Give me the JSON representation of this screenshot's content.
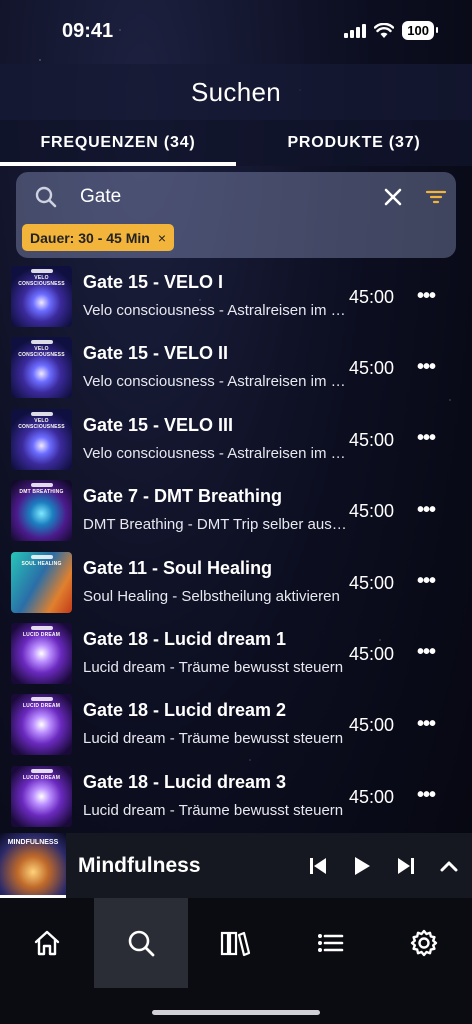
{
  "status_bar": {
    "time": "09:41",
    "battery": "100",
    "icons": [
      "signal-icon",
      "wifi-icon",
      "battery-icon"
    ]
  },
  "header": {
    "title": "Suchen"
  },
  "tabs": [
    {
      "label": "FREQUENZEN (34)",
      "active": true
    },
    {
      "label": "PRODUKTE (37)",
      "active": false
    }
  ],
  "search": {
    "value": "Gate",
    "placeholder": "Suchen",
    "icons": [
      "search-icon",
      "close-icon",
      "filter-icon"
    ],
    "filter_chip": {
      "label": "Dauer: 30 - 45 Min",
      "remove": "×"
    }
  },
  "results": [
    {
      "title": "Gate 15 - VELO I",
      "subtitle": "Velo consciousness - Astralreisen im Klarbewusstsein",
      "duration": "45:00",
      "thumb_label": "VELO CONSCIOUSNESS",
      "thumb_style": "velo"
    },
    {
      "title": "Gate 15 - VELO II",
      "subtitle": "Velo consciousness - Astralreisen im Klarbewusstsein",
      "duration": "45:00",
      "thumb_label": "VELO CONSCIOUSNESS",
      "thumb_style": "velo"
    },
    {
      "title": "Gate 15 - VELO III",
      "subtitle": "Velo consciousness - Astralreisen im Klarbewusstsein",
      "duration": "45:00",
      "thumb_label": "VELO CONSCIOUSNESS",
      "thumb_style": "velo"
    },
    {
      "title": "Gate 7 - DMT Breathing",
      "subtitle": "DMT Breathing - DMT Trip selber auslösen",
      "duration": "45:00",
      "thumb_label": "DMT BREATHING",
      "thumb_style": "dmt"
    },
    {
      "title": "Gate 11 - Soul Healing",
      "subtitle": "Soul Healing - Selbstheilung aktivieren",
      "duration": "45:00",
      "thumb_label": "SOUL HEALING",
      "thumb_style": "soul"
    },
    {
      "title": "Gate 18 - Lucid dream 1",
      "subtitle": "Lucid dream - Träume bewusst steuern",
      "duration": "45:00",
      "thumb_label": "LUCID DREAM",
      "thumb_style": "lucid"
    },
    {
      "title": "Gate 18 - Lucid dream 2",
      "subtitle": "Lucid dream - Träume bewusst steuern",
      "duration": "45:00",
      "thumb_label": "LUCID DREAM",
      "thumb_style": "lucid"
    },
    {
      "title": "Gate 18 - Lucid dream 3",
      "subtitle": "Lucid dream - Träume bewusst steuern",
      "duration": "45:00",
      "thumb_label": "LUCID DREAM",
      "thumb_style": "lucid"
    }
  ],
  "player": {
    "title": "Mindfulness",
    "thumb_label": "MINDFULNESS",
    "controls": [
      "skip-back-icon",
      "play-icon",
      "skip-forward-icon",
      "chevron-up-icon"
    ]
  },
  "nav": [
    {
      "name": "home",
      "icon": "home-icon",
      "active": false
    },
    {
      "name": "search",
      "icon": "search-icon",
      "active": true
    },
    {
      "name": "library",
      "icon": "library-icon",
      "active": false
    },
    {
      "name": "playlists",
      "icon": "list-icon",
      "active": false
    },
    {
      "name": "settings",
      "icon": "gear-icon",
      "active": false
    }
  ],
  "colors": {
    "accent_chip": "#f2b43a",
    "filter_icon": "#f2b43a"
  }
}
